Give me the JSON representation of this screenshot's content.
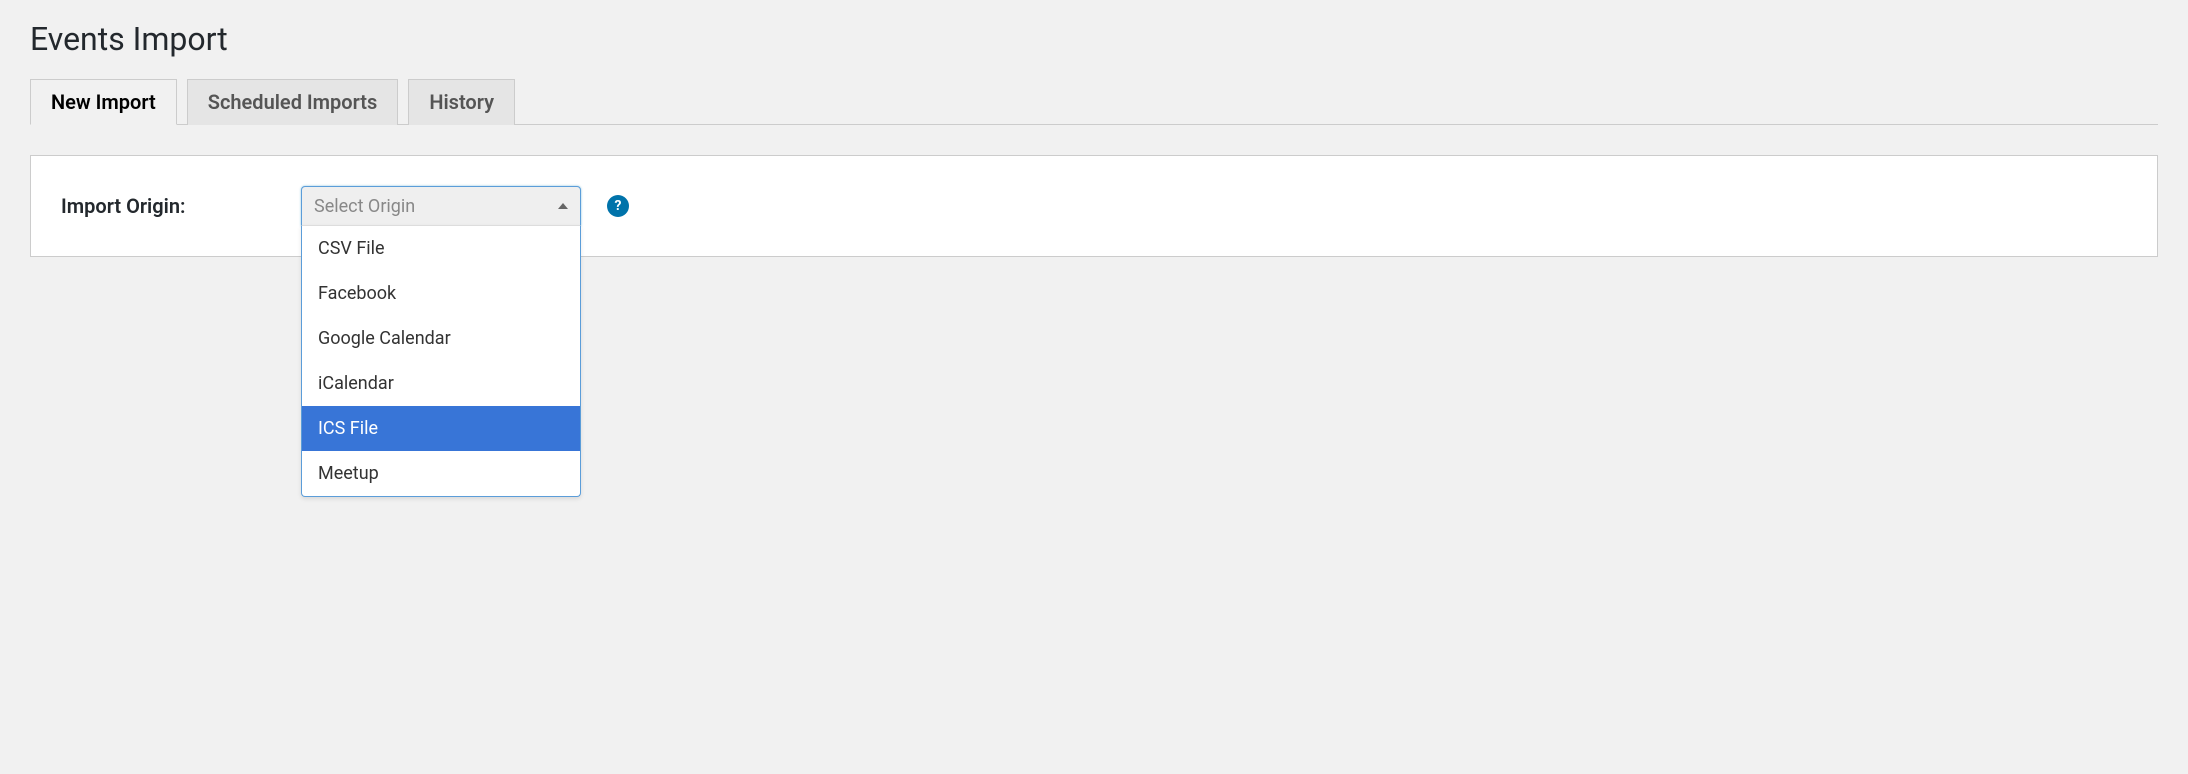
{
  "page": {
    "title": "Events Import"
  },
  "tabs": {
    "items": [
      {
        "label": "New Import",
        "active": true
      },
      {
        "label": "Scheduled Imports",
        "active": false
      },
      {
        "label": "History",
        "active": false
      }
    ]
  },
  "form": {
    "origin_label": "Import Origin:",
    "select": {
      "placeholder": "Select Origin",
      "options": [
        {
          "label": "CSV File",
          "highlighted": false
        },
        {
          "label": "Facebook",
          "highlighted": false
        },
        {
          "label": "Google Calendar",
          "highlighted": false
        },
        {
          "label": "iCalendar",
          "highlighted": false
        },
        {
          "label": "ICS File",
          "highlighted": true
        },
        {
          "label": "Meetup",
          "highlighted": false
        }
      ]
    },
    "help_icon": "?"
  }
}
